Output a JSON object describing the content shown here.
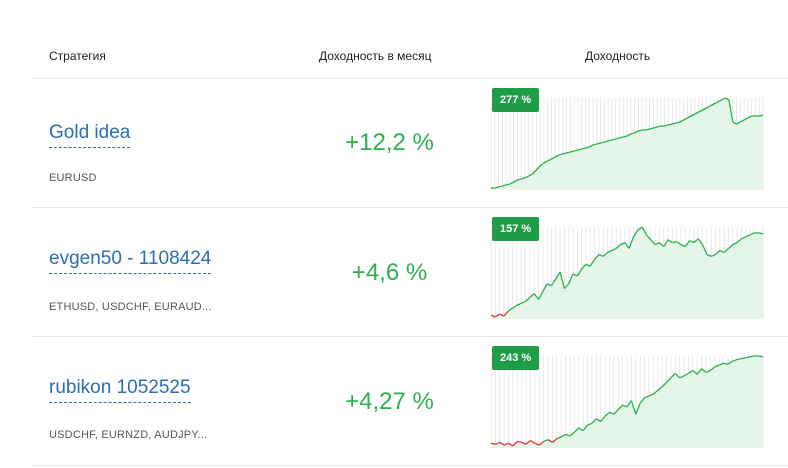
{
  "header": {
    "strategy": "Стратегия",
    "monthly": "Доходность в месяц",
    "return": "Доходность"
  },
  "rows": [
    {
      "name": "Gold idea",
      "pairs": "EURUSD",
      "monthly": "+12,2 %",
      "total_badge": "277 %",
      "line_color": "#2bb24c",
      "negative_color": "#e0373b",
      "fill_color": "#e6f5ea",
      "series": [
        0,
        0,
        1,
        2,
        3,
        4,
        6,
        8,
        9,
        10,
        12,
        14,
        18,
        22,
        25,
        27,
        29,
        31,
        33,
        34,
        35,
        36,
        37,
        38,
        39,
        40,
        41,
        43,
        44,
        45,
        46,
        47,
        48,
        49,
        50,
        51,
        52,
        54,
        55,
        57,
        58,
        58,
        59,
        60,
        61,
        62,
        62,
        63,
        64,
        65,
        66,
        68,
        70,
        72,
        74,
        76,
        78,
        80,
        82,
        84,
        86,
        88,
        90,
        88,
        66,
        64,
        66,
        68,
        70,
        72,
        72,
        72,
        73
      ]
    },
    {
      "name": "evgen50 - 1108424",
      "pairs": "ETHUSD, USDCHF, EURAUD...",
      "monthly": "+4,6 %",
      "total_badge": "157 %",
      "line_color": "#2bb24c",
      "negative_color": "#e0373b",
      "fill_color": "#e6f5ea",
      "series": [
        -2,
        -4,
        -1,
        -3,
        2,
        5,
        8,
        10,
        12,
        16,
        20,
        14,
        22,
        30,
        28,
        35,
        42,
        25,
        30,
        40,
        38,
        45,
        50,
        48,
        55,
        60,
        58,
        62,
        64,
        66,
        70,
        72,
        66,
        78,
        85,
        88,
        80,
        75,
        70,
        72,
        68,
        75,
        72,
        73,
        70,
        68,
        74,
        72,
        76,
        70,
        60,
        58,
        60,
        64,
        62,
        66,
        70,
        72,
        76,
        78,
        80,
        82,
        82,
        81
      ]
    },
    {
      "name": "rubikon 1052525",
      "pairs": "USDCHF, EURNZD, AUDJPY...",
      "monthly": "+4,27 %",
      "total_badge": "243 %",
      "line_color": "#2bb24c",
      "negative_color": "#e0373b",
      "fill_color": "#e6f5ea",
      "series": [
        -2,
        -3,
        -1,
        -4,
        -2,
        -5,
        0,
        -1,
        -3,
        1,
        -2,
        -4,
        0,
        2,
        -1,
        3,
        5,
        8,
        6,
        10,
        15,
        12,
        18,
        20,
        25,
        22,
        28,
        32,
        30,
        35,
        40,
        38,
        45,
        30,
        42,
        48,
        50,
        52,
        56,
        60,
        65,
        70,
        75,
        70,
        72,
        75,
        78,
        74,
        80,
        76,
        78,
        82,
        84,
        86,
        85,
        88,
        90,
        91,
        92,
        93,
        94,
        94,
        93
      ]
    }
  ]
}
